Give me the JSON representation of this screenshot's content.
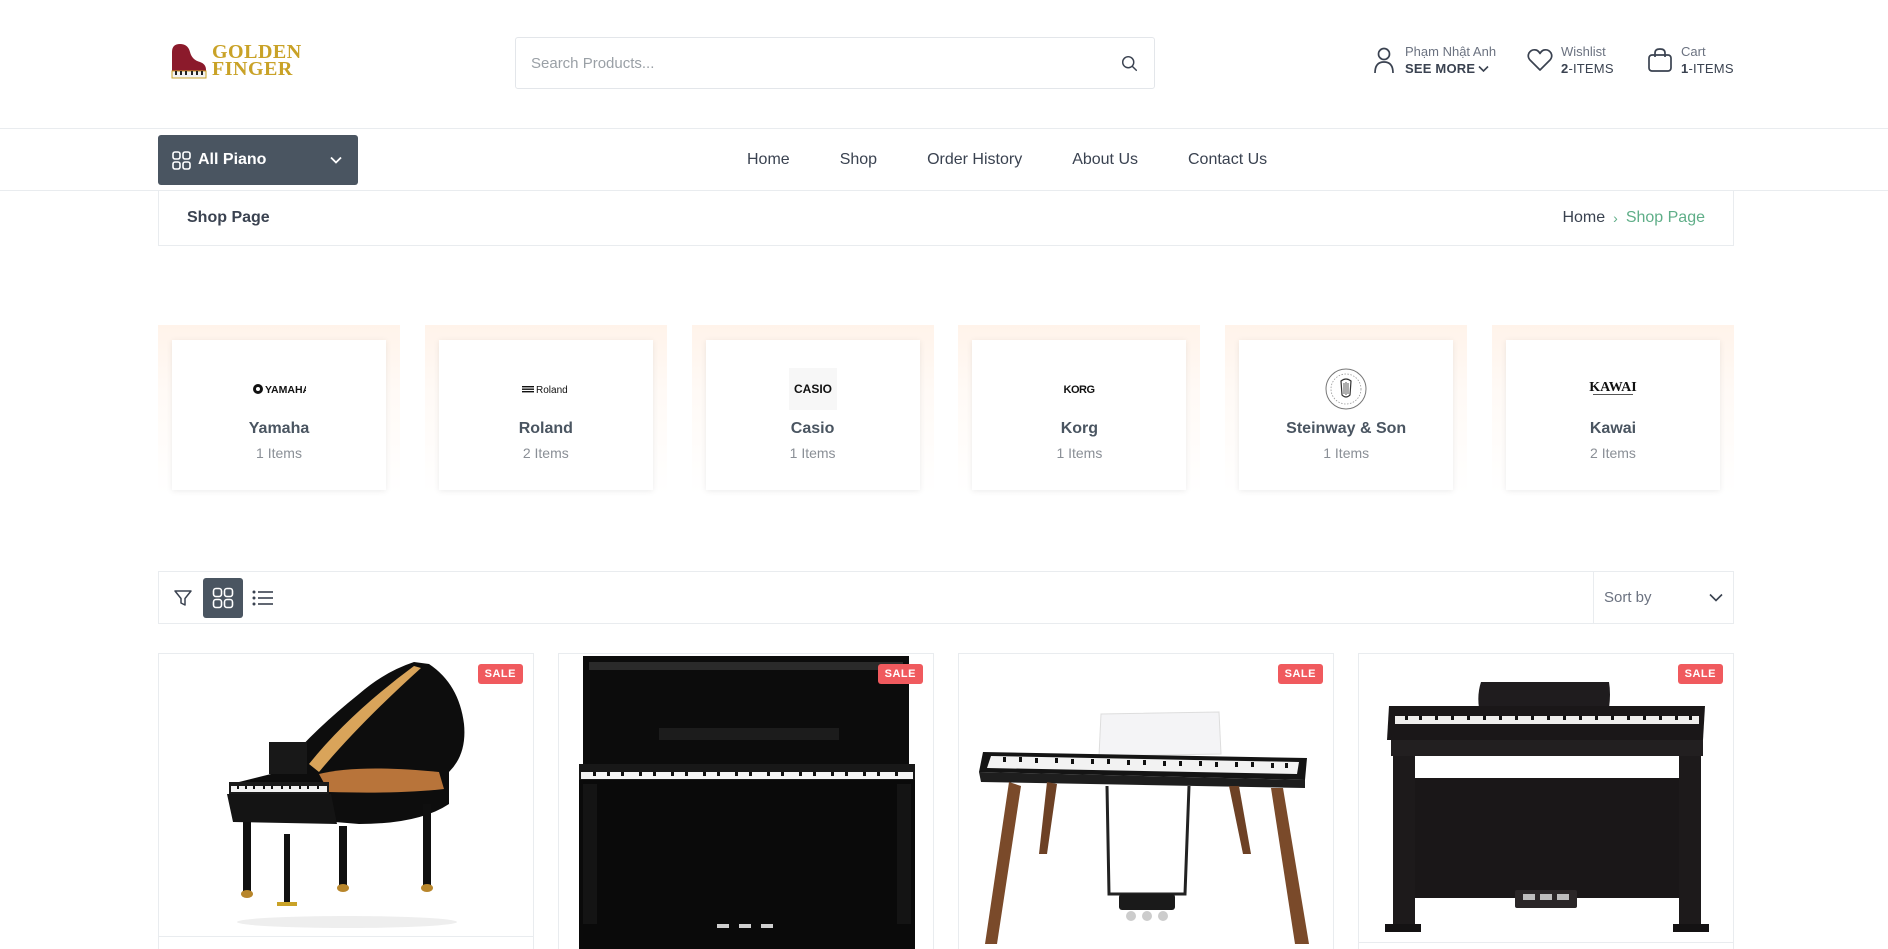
{
  "brand": {
    "logo_line1": "GOLDEN",
    "logo_line2": "FINGER"
  },
  "search": {
    "placeholder": "Search Products..."
  },
  "account": {
    "name": "Phạm Nhật Anh",
    "sub": "SEE MORE"
  },
  "wishlist": {
    "label": "Wishlist",
    "count": "2",
    "suffix": "-ITEMS"
  },
  "cart": {
    "label": "Cart",
    "count": "1",
    "suffix": "-ITEMS"
  },
  "category_button": {
    "label": "All Piano"
  },
  "nav": {
    "items": [
      "Home",
      "Shop",
      "Order History",
      "About Us",
      "Contact Us"
    ]
  },
  "breadcrumb": {
    "title": "Shop Page",
    "home": "Home",
    "current": "Shop Page"
  },
  "brands": [
    {
      "logo": "YAMAHA",
      "name": "Yamaha",
      "count": "1 Items"
    },
    {
      "logo": "Roland",
      "name": "Roland",
      "count": "2 Items"
    },
    {
      "logo": "CASIO",
      "name": "Casio",
      "count": "1 Items"
    },
    {
      "logo": "KORG",
      "name": "Korg",
      "count": "1 Items"
    },
    {
      "logo": "steinway-crest",
      "name": "Steinway & Son",
      "count": "1 Items"
    },
    {
      "logo": "KAWAI",
      "name": "Kawai",
      "count": "2 Items"
    }
  ],
  "toolbar": {
    "sort_label": "Sort by",
    "view": "grid"
  },
  "products": [
    {
      "badge": "SALE",
      "image": "grand-piano"
    },
    {
      "badge": "SALE",
      "image": "upright-piano"
    },
    {
      "badge": "SALE",
      "image": "digital-piano-stand"
    },
    {
      "badge": "SALE",
      "image": "digital-piano-cabinet"
    }
  ],
  "colors": {
    "accent": "#4a5561",
    "gold": "#c9a227",
    "sale": "#f05a5e",
    "breadcrumb_active": "#5fae88"
  }
}
